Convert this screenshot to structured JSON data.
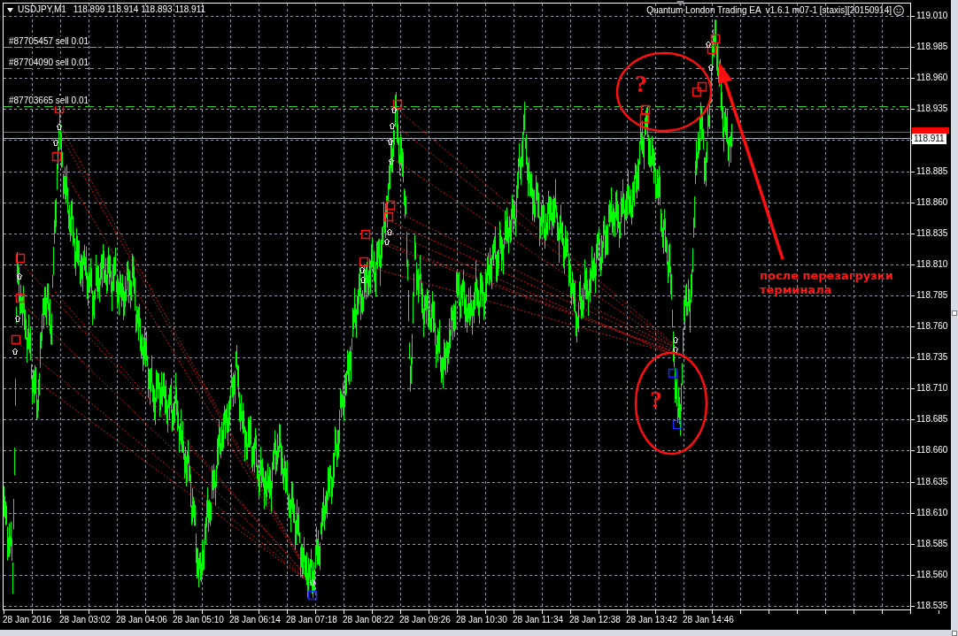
{
  "chart": {
    "symbol": "USDJPY,M1",
    "quote": "118.899 118.914 118.893 118.911",
    "expert_name": "Quantum London Trading EA",
    "expert_version": "v1.6.1 m07-1 [staxis][20150914]"
  },
  "orders": [
    {
      "label": "#87705457 sell 0.01"
    },
    {
      "label": "#87704090 sell 0.01"
    },
    {
      "label": "#87703665 sell 0.01"
    }
  ],
  "price_axis": {
    "labels": [
      "119.010",
      "118.985",
      "118.960",
      "118.935",
      "118.885",
      "118.860",
      "118.835",
      "118.810",
      "118.785",
      "118.760",
      "118.735",
      "118.710",
      "118.685",
      "118.660",
      "118.635",
      "118.610",
      "118.585",
      "118.560",
      "118.535"
    ],
    "current_price": "118.911"
  },
  "time_axis": {
    "labels": [
      "28 Jan 2016",
      "28 Jan 03:02",
      "28 Jan 04:06",
      "28 Jan 05:10",
      "28 Jan 06:14",
      "28 Jan 07:18",
      "28 Jan 08:22",
      "28 Jan 09:26",
      "28 Jan 10:30",
      "28 Jan 11:34",
      "28 Jan 12:38",
      "28 Jan 13:42",
      "28 Jan 14:46"
    ]
  },
  "annotations": [
    {
      "kind": "question",
      "text": "?"
    },
    {
      "kind": "question",
      "text": "?"
    },
    {
      "kind": "note",
      "text": "после перезагрузки терминала"
    }
  ]
}
